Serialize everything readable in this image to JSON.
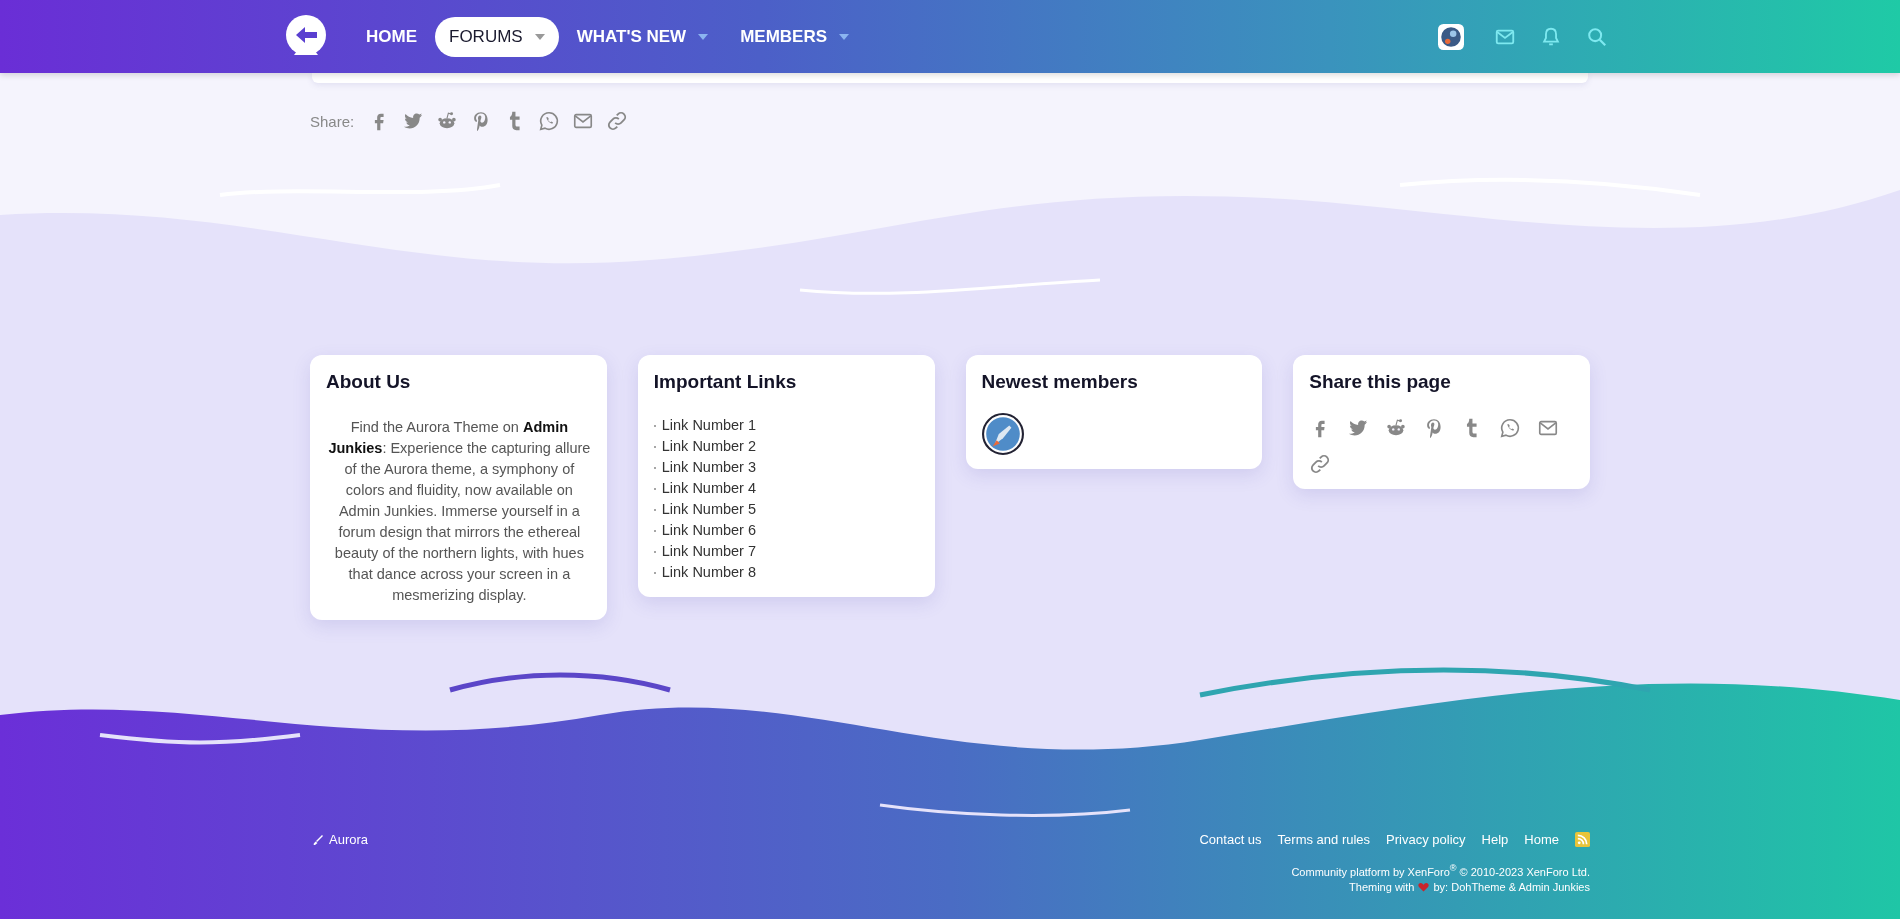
{
  "nav": {
    "items": [
      {
        "label": "HOME",
        "selected": false,
        "dropdown": false
      },
      {
        "label": "FORUMS",
        "selected": true,
        "dropdown": true
      },
      {
        "label": "WHAT'S NEW",
        "selected": false,
        "dropdown": true
      },
      {
        "label": "MEMBERS",
        "selected": false,
        "dropdown": true
      }
    ]
  },
  "share": {
    "label": "Share:"
  },
  "cards": [
    {
      "kind": "text",
      "title": "About Us",
      "text": "Find the Aurora Theme on **Admin Junkies**: Experience the capturing allure of the Aurora theme, a symphony of colors and fluidity, now available on Admin Junkies. Immerse yourself in a forum design that mirrors the ethereal beauty of the northern lights, with hues that dance across your screen in a mesmerizing display."
    },
    {
      "kind": "links",
      "title": "Important Links",
      "links": [
        "Link Number 1",
        "Link Number 2",
        "Link Number 3",
        "Link Number 4",
        "Link Number 5",
        "Link Number 6",
        "Link Number 7",
        "Link Number 8"
      ]
    },
    {
      "kind": "members",
      "title": "Newest members"
    },
    {
      "kind": "share",
      "title": "Share this page"
    }
  ],
  "footer": {
    "style_name": "Aurora",
    "links": [
      "Contact us",
      "Terms and rules",
      "Privacy policy",
      "Help",
      "Home"
    ],
    "copyright": "Community platform by XenForo$^{®}$ © 2010-2023 XenForo Ltd.",
    "theming_prefix": "Theming with",
    "theming_suffix": "by: DohTheme & Admin Junkies"
  }
}
